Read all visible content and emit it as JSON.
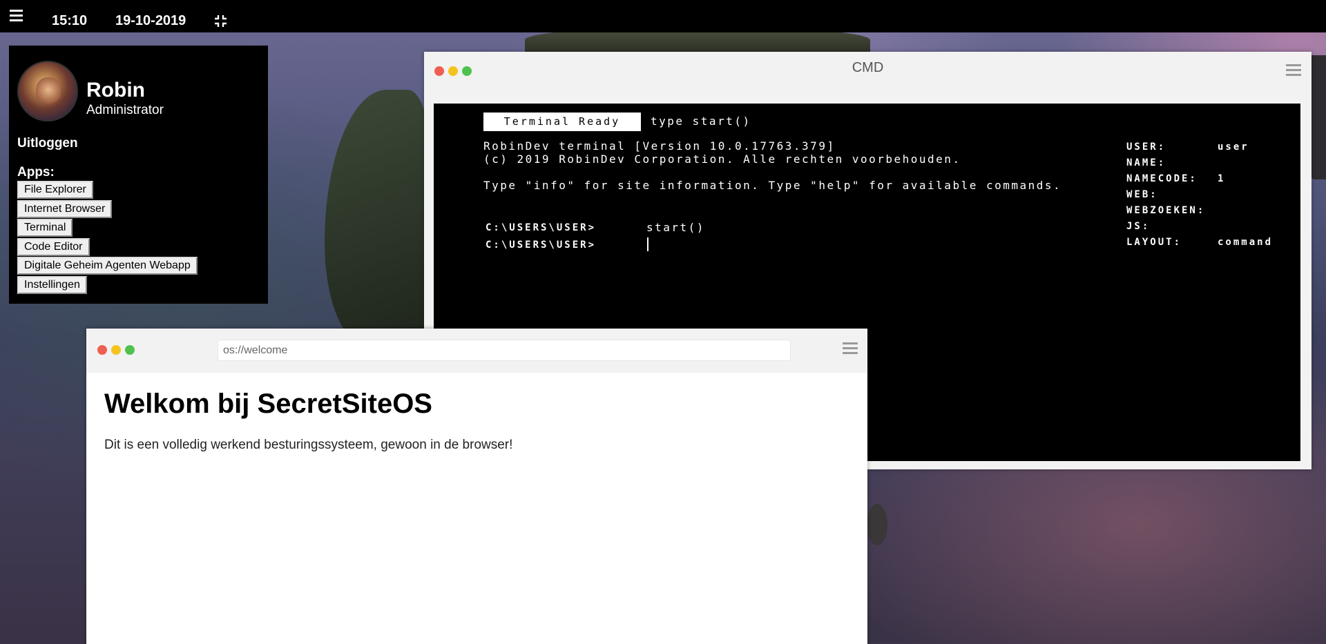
{
  "topbar": {
    "time": "15:10",
    "date": "19-10-2019",
    "icons": [
      "hamburger-menu-icon",
      "compress-icon"
    ]
  },
  "user": {
    "name": "Robin",
    "role": "Administrator",
    "logout_label": "Uitloggen",
    "apps_label": "Apps:",
    "apps": [
      "File Explorer",
      "Internet Browser",
      "Terminal",
      "Code Editor",
      "Digitale Geheim Agenten Webapp",
      "Instellingen"
    ]
  },
  "cmd": {
    "title": "CMD",
    "ready_label": "Terminal Ready",
    "hint": "type start()",
    "lines": [
      "RobinDev terminal [Version 10.0.17763.379]",
      "(c) 2019 RobinDev Corporation. Alle rechten voorbehouden.",
      "Type \"info\" for site information. Type \"help\" for available commands."
    ],
    "history": [
      {
        "prompt": "C:\\USERS\\USER>",
        "command": "start()"
      },
      {
        "prompt": "C:\\USERS\\USER>",
        "command": ""
      }
    ],
    "info": [
      {
        "key": "USER:",
        "value": "user"
      },
      {
        "key": "NAME:",
        "value": ""
      },
      {
        "key": "NAMECODE:",
        "value": "1"
      },
      {
        "key": "WEB:",
        "value": ""
      },
      {
        "key": "WEBZOEKEN:",
        "value": ""
      },
      {
        "key": "JS:",
        "value": ""
      },
      {
        "key": "LAYOUT:",
        "value": "command"
      }
    ]
  },
  "browser": {
    "url": "os://welcome",
    "heading": "Welkom bij SecretSiteOS",
    "text": "Dit is een volledig werkend besturingssysteem, gewoon in de browser!"
  },
  "colors": {
    "window_close": "#f05e52",
    "window_minimize": "#f5c320",
    "window_maximize": "#4fc24d",
    "terminal_bg": "#000000",
    "topbar_bg": "#000000"
  }
}
